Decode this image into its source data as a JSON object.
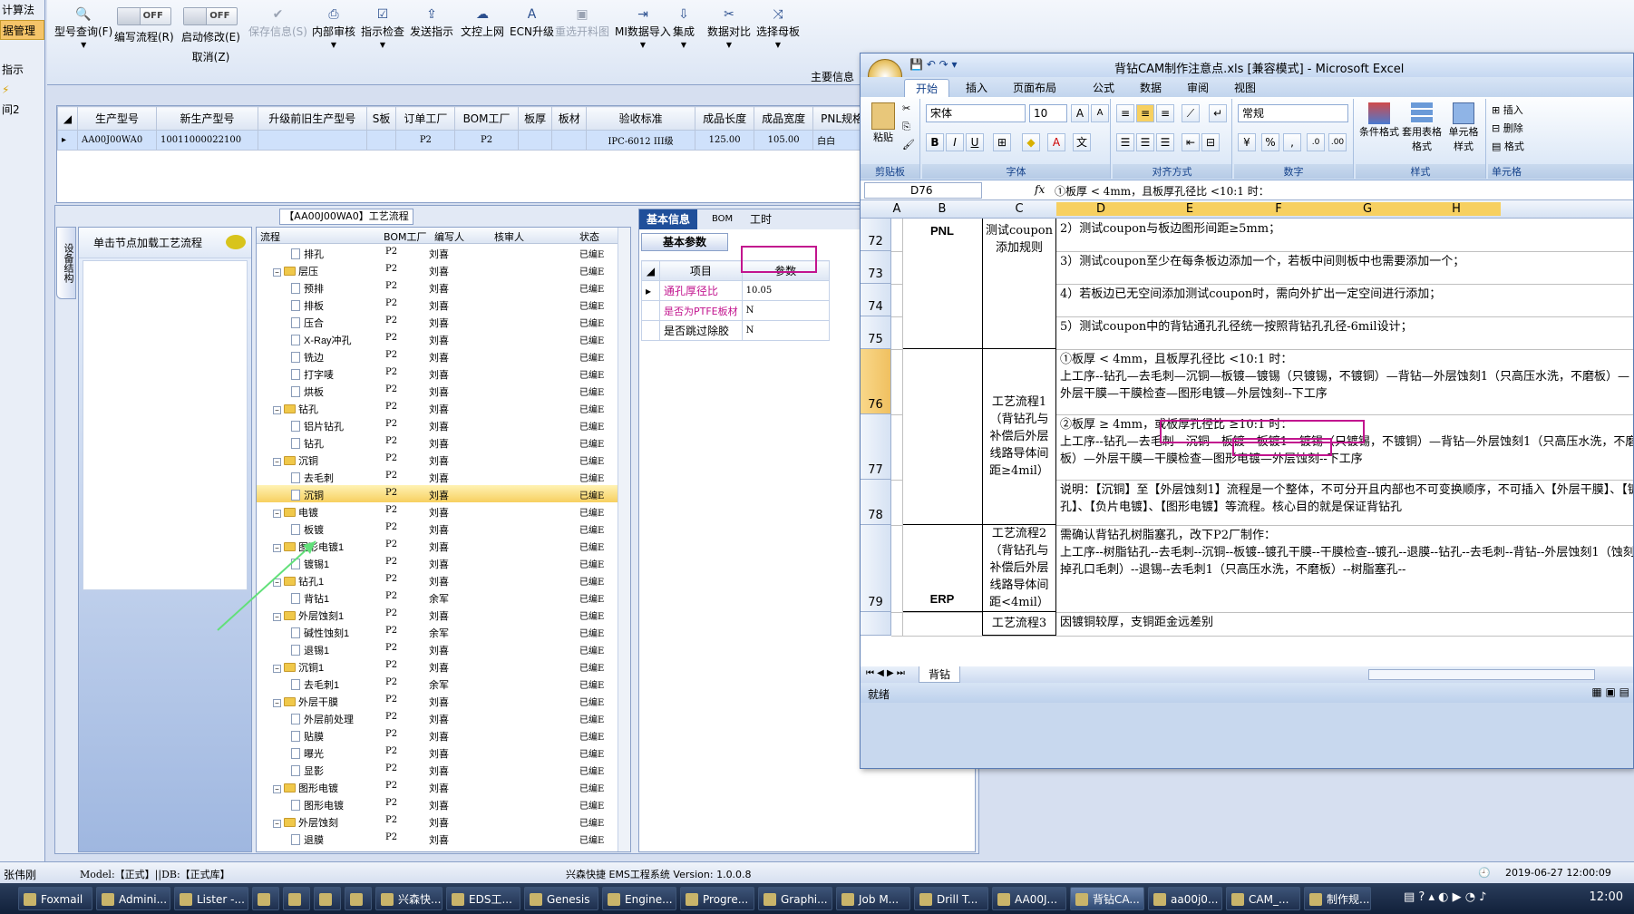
{
  "left_nav": {
    "items": [
      {
        "label": "计算法",
        "selected": false
      },
      {
        "label": "据管理",
        "selected": true
      },
      {
        "label": "",
        "selected": false
      },
      {
        "label": "指示",
        "selected": false
      },
      {
        "label": "",
        "selected": false
      },
      {
        "label": "间2",
        "selected": false
      }
    ]
  },
  "toolbar": {
    "query": "型号查询(F)",
    "edit_flow_toggle": "OFF",
    "edit_flow": "编写流程(R)",
    "start_modify_toggle": "OFF",
    "start_modify": "启动修改(E)",
    "cancel": "取消(Z)",
    "save_info": "保存信息(S)",
    "internal_review": "内部审核",
    "indicator_check": "指示检查",
    "send_indicator": "发送指示",
    "upload_doc": "文控上网",
    "ecn_upgrade": "ECN升级",
    "regen_map": "重选开料图",
    "mi_import": "MI数据导入",
    "integrate": "集成",
    "data_compare": "数据对比",
    "select_master": "选择母板",
    "main_info": "主要信息"
  },
  "grid": {
    "columns": [
      "生产型号",
      "新生产型号",
      "升级前旧生产型号",
      "S板",
      "订单工厂",
      "BOM工厂",
      "板厚",
      "板材",
      "验收标准",
      "成品长度",
      "成品宽度",
      "PNL规格"
    ],
    "rows": [
      [
        "AA00J00WA0",
        "10011000022100",
        "",
        "",
        "P2",
        "P2",
        "",
        "",
        "IPC-6012 III级",
        "125.00",
        "105.00",
        "白白"
      ]
    ]
  },
  "side_tab": "设备结构",
  "node_panel": {
    "header": "单击节点加载工艺流程"
  },
  "flow_title": "【AA00J00WA0】工艺流程",
  "tree": {
    "columns": [
      "流程",
      "BOM工厂",
      "编写人",
      "核审人",
      "状态"
    ],
    "rows": [
      {
        "level": 2,
        "type": "doc",
        "name": "排孔",
        "bom": "P2",
        "author": "刘喜",
        "status": "已编E"
      },
      {
        "level": 1,
        "type": "folder",
        "name": "层压",
        "bom": "P2",
        "author": "刘喜",
        "status": "已编E"
      },
      {
        "level": 2,
        "type": "doc",
        "name": "预排",
        "bom": "P2",
        "author": "刘喜",
        "status": "已编E"
      },
      {
        "level": 2,
        "type": "doc",
        "name": "排板",
        "bom": "P2",
        "author": "刘喜",
        "status": "已编E"
      },
      {
        "level": 2,
        "type": "doc",
        "name": "压合",
        "bom": "P2",
        "author": "刘喜",
        "status": "已编E"
      },
      {
        "level": 2,
        "type": "doc",
        "name": "X-Ray冲孔",
        "bom": "P2",
        "author": "刘喜",
        "status": "已编E"
      },
      {
        "level": 2,
        "type": "doc",
        "name": "铣边",
        "bom": "P2",
        "author": "刘喜",
        "status": "已编E"
      },
      {
        "level": 2,
        "type": "doc",
        "name": "打字唛",
        "bom": "P2",
        "author": "刘喜",
        "status": "已编E"
      },
      {
        "level": 2,
        "type": "doc",
        "name": "烘板",
        "bom": "P2",
        "author": "刘喜",
        "status": "已编E"
      },
      {
        "level": 1,
        "type": "folder",
        "name": "钻孔",
        "bom": "P2",
        "author": "刘喜",
        "status": "已编E"
      },
      {
        "level": 2,
        "type": "doc",
        "name": "铝片钻孔",
        "bom": "P2",
        "author": "刘喜",
        "status": "已编E"
      },
      {
        "level": 2,
        "type": "doc",
        "name": "钻孔",
        "bom": "P2",
        "author": "刘喜",
        "status": "已编E"
      },
      {
        "level": 1,
        "type": "folder",
        "name": "沉铜",
        "bom": "P2",
        "author": "刘喜",
        "status": "已编E"
      },
      {
        "level": 2,
        "type": "doc",
        "name": "去毛刺",
        "bom": "P2",
        "author": "刘喜",
        "status": "已编E"
      },
      {
        "level": 2,
        "type": "doc",
        "name": "沉铜",
        "bom": "P2",
        "author": "刘喜",
        "status": "已编E",
        "selected": true
      },
      {
        "level": 1,
        "type": "folder",
        "name": "电镀",
        "bom": "P2",
        "author": "刘喜",
        "status": "已编E"
      },
      {
        "level": 2,
        "type": "doc",
        "name": "板镀",
        "bom": "P2",
        "author": "刘喜",
        "status": "已编E"
      },
      {
        "level": 1,
        "type": "folder",
        "name": "图形电镀1",
        "bom": "P2",
        "author": "刘喜",
        "status": "已编E"
      },
      {
        "level": 2,
        "type": "doc",
        "name": "镀锡1",
        "bom": "P2",
        "author": "刘喜",
        "status": "已编E"
      },
      {
        "level": 1,
        "type": "folder",
        "name": "钻孔1",
        "bom": "P2",
        "author": "刘喜",
        "status": "已编E"
      },
      {
        "level": 2,
        "type": "doc",
        "name": "背钻1",
        "bom": "P2",
        "author": "余军",
        "status": "已编E"
      },
      {
        "level": 1,
        "type": "folder",
        "name": "外层蚀刻1",
        "bom": "P2",
        "author": "刘喜",
        "status": "已编E"
      },
      {
        "level": 2,
        "type": "doc",
        "name": "碱性蚀刻1",
        "bom": "P2",
        "author": "余军",
        "status": "已编E"
      },
      {
        "level": 2,
        "type": "doc",
        "name": "退锡1",
        "bom": "P2",
        "author": "刘喜",
        "status": "已编E"
      },
      {
        "level": 1,
        "type": "folder",
        "name": "沉铜1",
        "bom": "P2",
        "author": "刘喜",
        "status": "已编E"
      },
      {
        "level": 2,
        "type": "doc",
        "name": "去毛刺1",
        "bom": "P2",
        "author": "余军",
        "status": "已编E"
      },
      {
        "level": 1,
        "type": "folder",
        "name": "外层干膜",
        "bom": "P2",
        "author": "刘喜",
        "status": "已编E"
      },
      {
        "level": 2,
        "type": "doc",
        "name": "外层前处理",
        "bom": "P2",
        "author": "刘喜",
        "status": "已编E"
      },
      {
        "level": 2,
        "type": "doc",
        "name": "贴膜",
        "bom": "P2",
        "author": "刘喜",
        "status": "已编E"
      },
      {
        "level": 2,
        "type": "doc",
        "name": "曝光",
        "bom": "P2",
        "author": "刘喜",
        "status": "已编E"
      },
      {
        "level": 2,
        "type": "doc",
        "name": "显影",
        "bom": "P2",
        "author": "刘喜",
        "status": "已编E"
      },
      {
        "level": 1,
        "type": "folder",
        "name": "图形电镀",
        "bom": "P2",
        "author": "刘喜",
        "status": "已编E"
      },
      {
        "level": 2,
        "type": "doc",
        "name": "图形电镀",
        "bom": "P2",
        "author": "刘喜",
        "status": "已编E"
      },
      {
        "level": 1,
        "type": "folder",
        "name": "外层蚀刻",
        "bom": "P2",
        "author": "刘喜",
        "status": "已编E"
      },
      {
        "level": 2,
        "type": "doc",
        "name": "退膜",
        "bom": "P2",
        "author": "刘喜",
        "status": "已编E"
      }
    ]
  },
  "info_panel": {
    "tabs": [
      "基本信息",
      "BOM",
      "工时"
    ],
    "param_tab": "基本参数",
    "col_item": "项目",
    "col_param": "参数",
    "rows": [
      {
        "item": "通孔厚径比",
        "value": "10.05",
        "pink": true
      },
      {
        "item": "是否为PTFE板材",
        "value": "N",
        "pink": true
      },
      {
        "item": "是否跳过除胶",
        "value": "N",
        "pink": false
      }
    ]
  },
  "excel": {
    "title": "背钻CAM制作注意点.xls [兼容模式] - Microsoft Excel",
    "tabs": [
      "开始",
      "插入",
      "页面布局",
      "公式",
      "数据",
      "审阅",
      "视图"
    ],
    "ribbon": {
      "paste": "粘贴",
      "clipboard": "剪贴板",
      "font_name": "宋体",
      "font_size": "10",
      "font_group": "字体",
      "align_group": "对齐方式",
      "number_format": "常规",
      "number_group": "数字",
      "cond_format": "条件格式",
      "table_format": "套用表格格式",
      "cell_style": "单元格样式",
      "style_group": "样式",
      "insert": "插入",
      "delete": "删除",
      "format": "格式",
      "cells_group": "单元格"
    },
    "name_box": "D76",
    "fx": "fx",
    "formula": "①板厚 < 4mm，且板厚孔径比 <10:1 时：",
    "columns": [
      "A",
      "B",
      "C",
      "D",
      "E",
      "F",
      "G",
      "H"
    ],
    "rows": [
      {
        "num": "72",
        "b": "PNL",
        "c": "测试coupon添加规则",
        "d": "2）测试coupon与板边图形间距≥5mm；"
      },
      {
        "num": "73",
        "b": "",
        "c": "",
        "d": "3）测试coupon至少在每条板边添加一个，若板中间则板中也需要添加一个；"
      },
      {
        "num": "74",
        "b": "",
        "c": "",
        "d": "4）若板边已无空间添加测试coupon时，需向外扩出一定空间进行添加；"
      },
      {
        "num": "75",
        "b": "",
        "c": "",
        "d": "5）测试coupon中的背钻通孔孔径统一按照背钻孔孔径-6mil设计；"
      },
      {
        "num": "76",
        "b": "",
        "c": "工艺流程1（背钻孔与补偿后外层线路导体间距≥4mil）",
        "d": "①板厚 < 4mm，且板厚孔径比 <10:1 时：\n上工序--钻孔—去毛刺—沉铜—板镀—镀锡（只镀锡，不镀铜）—背钻—外层蚀刻1（只高压水洗，不磨板）—外层干膜—干膜检查—图形电镀—外层蚀刻--下工序"
      },
      {
        "num": "77",
        "b": "",
        "c": "",
        "d": "②板厚 ≥ 4mm，或板厚孔径比 ≥10:1 时：\n上工序--钻孔—去毛刺—沉铜—板镀—板镀1—镀锡（只镀锡，不镀铜）—背钻—外层蚀刻1（只高压水洗，不磨板）—外层干膜—干膜检查—图形电镀—外层蚀刻--下工序"
      },
      {
        "num": "78",
        "b": "",
        "c": "",
        "d": "说明：【沉铜】至【外层蚀刻1】流程是一个整体，不可分开且内部也不可变换顺序，不可插入【外层干膜】、【镀孔】、【负片电镀】、【图形电镀】等流程。核心目的就是保证背钻孔"
      },
      {
        "num": "79",
        "b": "ERP",
        "c": "工艺流程2（背钻孔与补偿后外层线路导体间距<4mil）",
        "d": "需确认背钻孔树脂塞孔，改下P2厂制作：\n上工序--树脂钻孔--去毛刺--沉铜--板镀--镀孔干膜--干膜检查--镀孔--退膜--钻孔--去毛刺--背钻--外层蚀刻1（蚀刻掉孔口毛刺）--退锡--去毛刺1（只高压水洗，不磨板）--树脂塞孔--"
      },
      {
        "num": "",
        "b": "",
        "c": "工艺流程3",
        "d": "因镀铜较厚，支铜距金远差别"
      }
    ],
    "sheet_tab": "背钻",
    "status": "就绪"
  },
  "status_bar": {
    "user": "张伟刚",
    "model": "Model:【正式】||DB:【正式库】",
    "system": "兴森快捷 EMS工程系统 Version: 1.0.0.8",
    "datetime": "2019-06-27 12:00:09"
  },
  "taskbar": {
    "items": [
      "Foxmail",
      "Admini...",
      "Lister -...",
      "",
      "",
      "",
      "",
      "兴森快...",
      "EDS工...",
      "Genesis",
      "Engine...",
      "Progre...",
      "Graphi...",
      "Job M...",
      "Drill T...",
      "AA00J...",
      "背钻CA...",
      "aa00j0...",
      "CAM_...",
      "制作规..."
    ],
    "clock": "12:00"
  },
  "colors": {
    "accent": "#1f4f9a",
    "highlight_box": "#c2148e",
    "selected_row": "#f7d060"
  }
}
